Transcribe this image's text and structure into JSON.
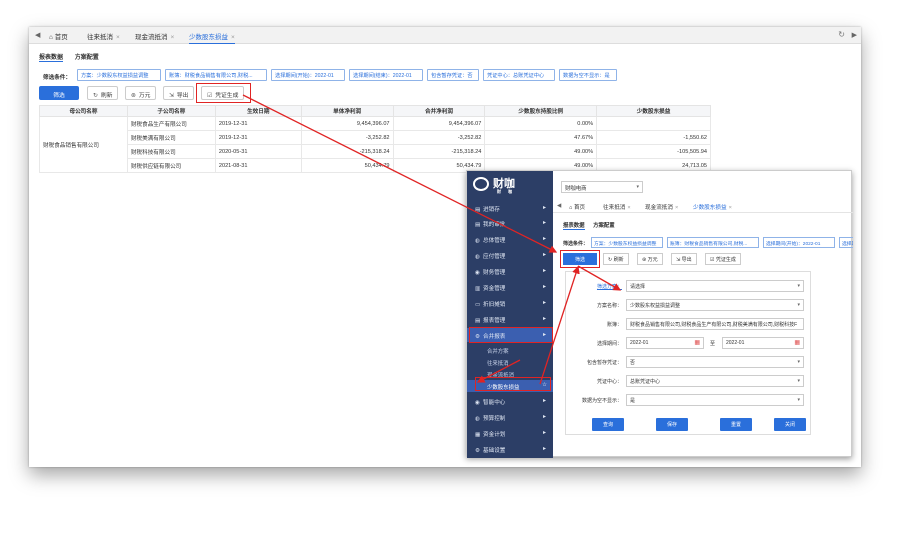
{
  "tabs": {
    "home": "首页",
    "items": [
      "往来抵消",
      "现金流抵消",
      "少数股东损益"
    ],
    "close": "×"
  },
  "subtabs": [
    "报表数据",
    "方案配置"
  ],
  "filter": {
    "label": "筛选条件：",
    "chips": [
      "方案：少数股东权益损益调整",
      "账簿：财税食品销售有限公司,财税...",
      "选择期间(开始)：2022-01",
      "选择期间(结束)：2022-01",
      "包含暂存凭证：否",
      "凭证中心：总账凭证中心",
      "数据为空不显示：是"
    ]
  },
  "toolbar": {
    "filter": "筛选",
    "refresh": "刷新",
    "unit": "万元",
    "export": "导出",
    "voucher": "凭证生成"
  },
  "table": {
    "headers": [
      "母公司名称",
      "子公司名称",
      "生效日期",
      "单体净利润",
      "合并净利润",
      "少数股东持股比例",
      "少数股东损益"
    ],
    "parent": "财税食品销售有限公司",
    "rows": [
      [
        "财税食品生产有限公司",
        "2019-12-31",
        "9,454,396.07",
        "9,454,396.07",
        "0.00%",
        ""
      ],
      [
        "财税美满有限公司",
        "2019-12-31",
        "-3,252.82",
        "-3,252.82",
        "47.67%",
        "-1,550.62"
      ],
      [
        "财税科技有限公司",
        "2020-05-31",
        "-215,318.24",
        "-215,318.24",
        "49.00%",
        "-105,505.94"
      ],
      [
        "财税供应链有限公司",
        "2021-08-31",
        "50,434.79",
        "50,434.79",
        "49.00%",
        "24,713.05"
      ]
    ]
  },
  "panel": {
    "logo": "财咖",
    "logo_sub": "财 咖",
    "org": "财咖电商",
    "menu": [
      {
        "label": "进销存",
        "icon": "▤"
      },
      {
        "label": "我的审批",
        "icon": "▤"
      },
      {
        "label": "总体管理",
        "icon": "◍"
      },
      {
        "label": "应付管理",
        "icon": "◍"
      },
      {
        "label": "财务管理",
        "icon": "◉"
      },
      {
        "label": "资金管理",
        "icon": "▥"
      },
      {
        "label": "折旧摊销",
        "icon": "▭"
      },
      {
        "label": "报表管理",
        "icon": "▤"
      },
      {
        "label": "合并报表",
        "icon": "⚙"
      }
    ],
    "submenu": [
      "合并方案",
      "往来抵消",
      "现金流抵消",
      "少数股东损益"
    ],
    "menu_after": [
      {
        "label": "智能中心",
        "icon": "◉"
      },
      {
        "label": "预算控制",
        "icon": "◍"
      },
      {
        "label": "资金计划",
        "icon": "▦"
      },
      {
        "label": "基础设置",
        "icon": "⚙"
      }
    ],
    "tabs": [
      "首页",
      "往来抵消",
      "现金流抵消",
      "少数股东损益"
    ],
    "subtabs": [
      "报表数据",
      "方案配置"
    ],
    "filter_label": "筛选条件：",
    "chips": [
      "方案：少数股东权益损益调整",
      "账簿：财税食品销售有限公司,财税...",
      "选择期间(开始)：2022-01",
      "选择期间"
    ],
    "toolbar": [
      "筛选",
      "刷新",
      "万元",
      "导出",
      "凭证生成"
    ],
    "form": {
      "scheme_label": "筛选方案：",
      "scheme_value": "请选择",
      "name_label": "方案名称：",
      "name_value": "少数股东权益损益调整",
      "book_label": "账簿：",
      "book_value": "财税食品销售有限公司,财税食品生产有限公司,财税美满有限公司,财税科技F",
      "period_label": "选择期间：",
      "period_start": "2022-01",
      "period_to": "至",
      "period_end": "2022-01",
      "staging_label": "包含暂存凭证：",
      "staging_value": "否",
      "center_label": "凭证中心：",
      "center_value": "总账凭证中心",
      "empty_label": "数据为空不显示：",
      "empty_value": "是",
      "buttons": [
        "查询",
        "保存",
        "重置",
        "关闭"
      ]
    }
  }
}
